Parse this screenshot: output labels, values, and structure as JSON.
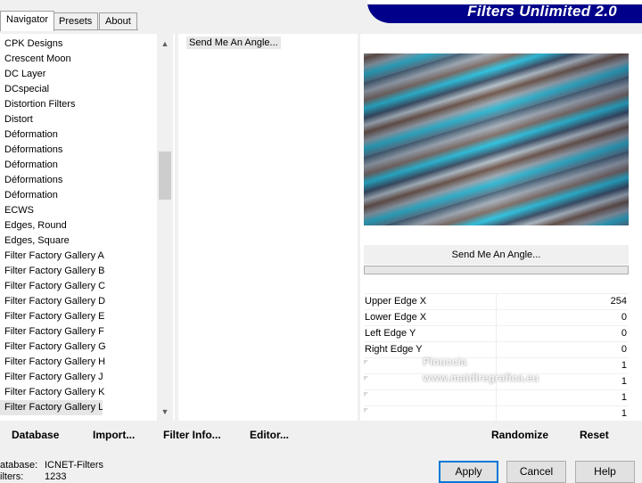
{
  "banner": {
    "title": "Filters Unlimited 2.0"
  },
  "tabs": [
    {
      "label": "Navigator"
    },
    {
      "label": "Presets"
    },
    {
      "label": "About"
    }
  ],
  "categories": [
    {
      "label": "CPK Designs"
    },
    {
      "label": "Crescent Moon"
    },
    {
      "label": "DC Layer"
    },
    {
      "label": "DCspecial"
    },
    {
      "label": "Distortion Filters"
    },
    {
      "label": "Distort"
    },
    {
      "label": "Déformation"
    },
    {
      "label": "Déformations"
    },
    {
      "label": "Déformation"
    },
    {
      "label": "Déformations"
    },
    {
      "label": "Déformation"
    },
    {
      "label": "ECWS"
    },
    {
      "label": "Edges, Round"
    },
    {
      "label": "Edges, Square"
    },
    {
      "label": "Filter Factory Gallery A"
    },
    {
      "label": "Filter Factory Gallery B"
    },
    {
      "label": "Filter Factory Gallery C"
    },
    {
      "label": "Filter Factory Gallery D"
    },
    {
      "label": "Filter Factory Gallery E"
    },
    {
      "label": "Filter Factory Gallery F"
    },
    {
      "label": "Filter Factory Gallery G"
    },
    {
      "label": "Filter Factory Gallery H"
    },
    {
      "label": "Filter Factory Gallery J"
    },
    {
      "label": "Filter Factory Gallery K"
    },
    {
      "label": "Filter Factory Gallery L"
    }
  ],
  "selected_category_index": 24,
  "filters": [
    {
      "label": "Send Me An Angle..."
    }
  ],
  "preview": {
    "filter_name": "Send Me An Angle..."
  },
  "params": [
    {
      "label": "Upper Edge X",
      "value": "254"
    },
    {
      "label": "Lower Edge X",
      "value": "0"
    },
    {
      "label": "Left Edge Y",
      "value": "0"
    },
    {
      "label": "Right Edge Y",
      "value": "0"
    },
    {
      "label": "",
      "value": "1"
    },
    {
      "label": "",
      "value": "1"
    },
    {
      "label": "",
      "value": "1"
    },
    {
      "label": "",
      "value": "1"
    }
  ],
  "toolbar": {
    "database": "Database",
    "import": "Import...",
    "filter_info": "Filter Info...",
    "editor": "Editor...",
    "randomize": "Randomize",
    "reset": "Reset"
  },
  "status": {
    "database_label": "atabase:",
    "database_value": "ICNET-Filters",
    "filters_label": "ilters:",
    "filters_value": "1233"
  },
  "buttons": {
    "apply": "Apply",
    "cancel": "Cancel",
    "help": "Help"
  },
  "watermark": {
    "name": "Pinuccia",
    "site": "www.maidiregrafica.eu"
  }
}
